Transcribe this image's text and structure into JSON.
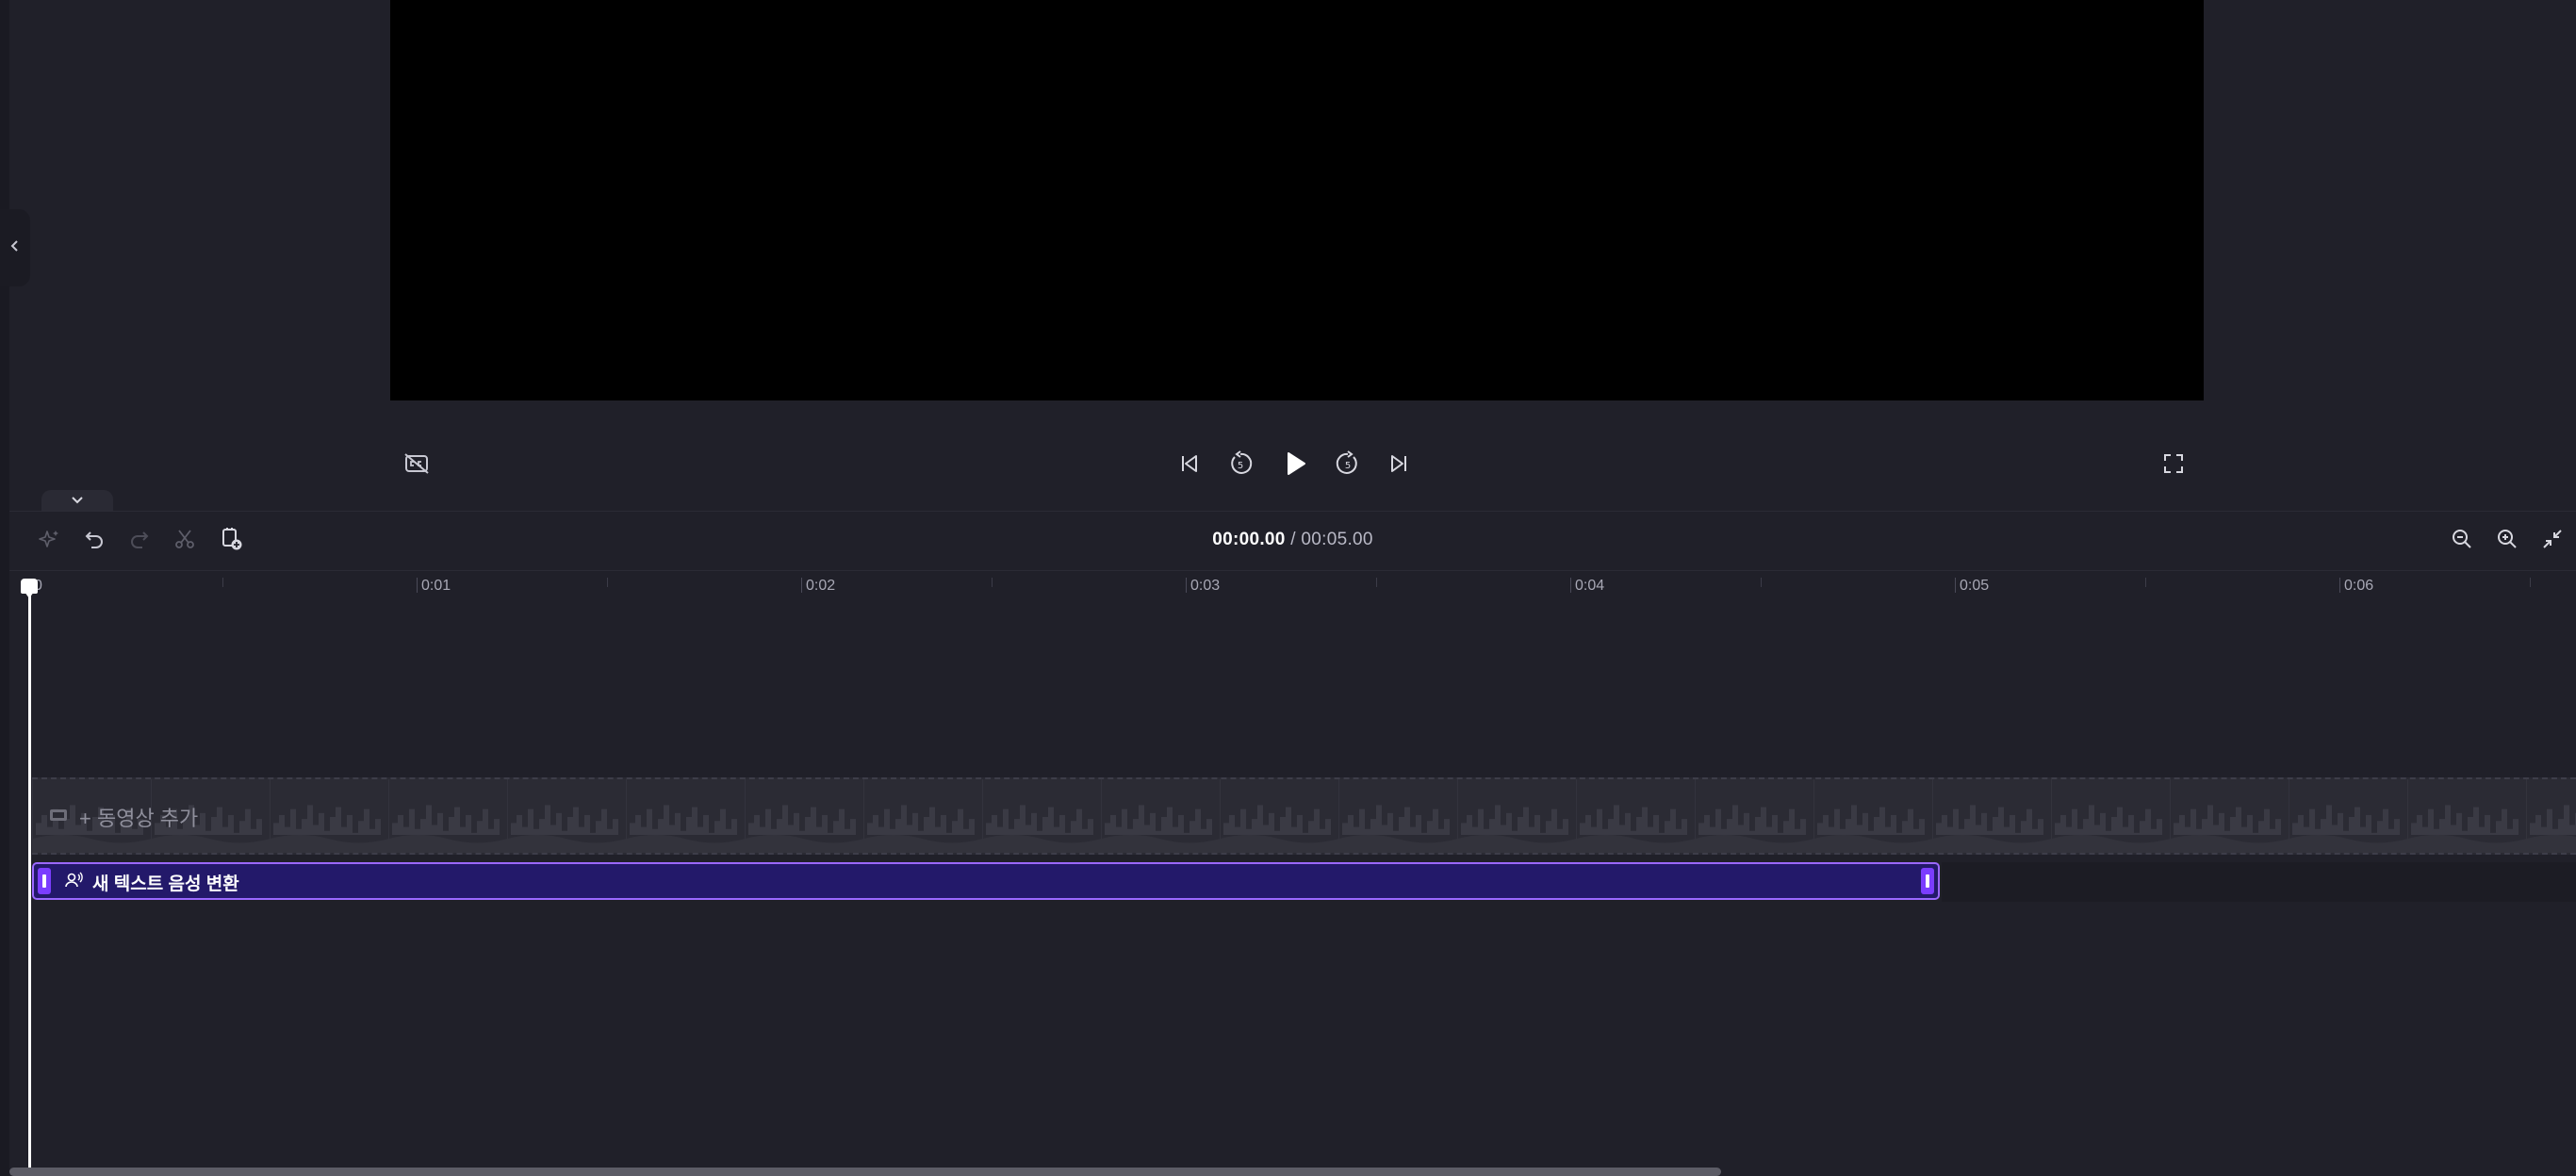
{
  "timeline": {
    "current_time": "00:00.00",
    "separator": "/",
    "total_time": "00:05.00"
  },
  "ruler": {
    "ticks": [
      "0:01",
      "0:02",
      "0:03",
      "0:04",
      "0:05",
      "0:06"
    ]
  },
  "video_track": {
    "add_label": "+ 동영상 추가"
  },
  "audio_clip": {
    "label": "새 텍스트 음성 변환"
  },
  "colors": {
    "background": "#202029",
    "preview": "#000000",
    "clip_fill": "#23196a",
    "clip_border": "#9b68ff",
    "clip_handle": "#7b3dff"
  },
  "icons": {
    "collapse_panel": "chevron-left-icon",
    "captions_off": "captions-off-icon",
    "skip_start": "skip-to-start-icon",
    "rewind_5": "rewind-5-seconds-icon",
    "play": "play-icon",
    "forward_5": "forward-5-seconds-icon",
    "skip_end": "skip-to-end-icon",
    "fullscreen": "fullscreen-icon",
    "timeline_collapse": "chevron-down-icon",
    "magic": "sparkle-icon",
    "undo": "undo-icon",
    "redo": "redo-icon",
    "split": "scissors-icon",
    "duplicate": "copy-add-icon",
    "zoom_out": "zoom-out-icon",
    "zoom_in": "zoom-in-icon",
    "fit_timeline": "fit-to-screen-icon",
    "video_track": "film-icon",
    "clip_type": "voice-icon"
  }
}
